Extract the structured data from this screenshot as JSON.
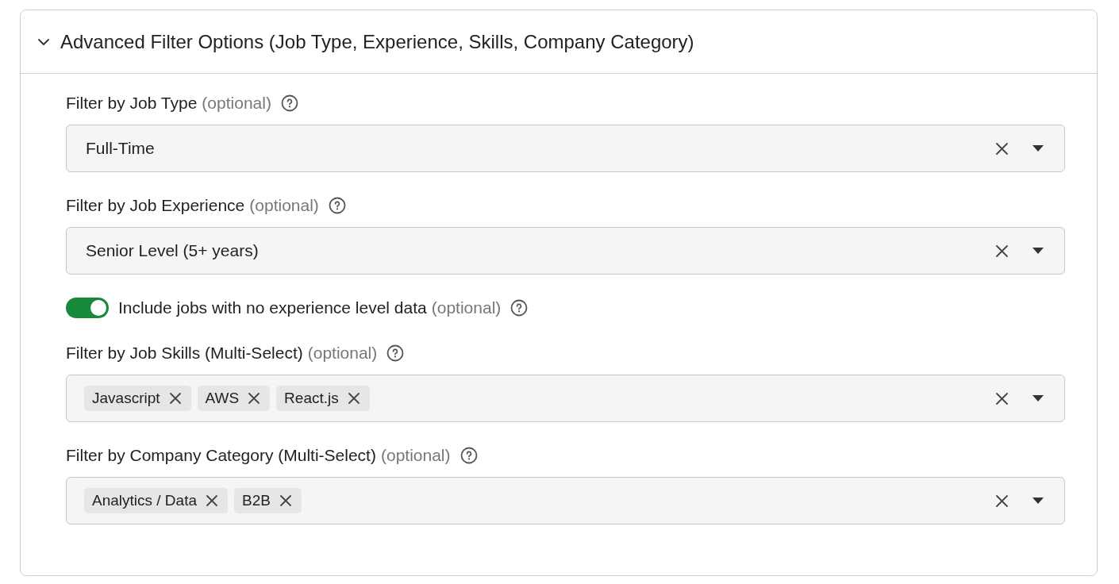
{
  "panel": {
    "title": "Advanced Filter Options (Job Type, Experience, Skills, Company Category)",
    "expanded": true
  },
  "fields": [
    {
      "kind": "select",
      "label": "Filter by Job Type",
      "hint": "(optional)",
      "value": "Full-Time"
    },
    {
      "kind": "select",
      "label": "Filter by Job Experience",
      "hint": "(optional)",
      "value": "Senior Level (5+ years)"
    },
    {
      "kind": "toggle",
      "label": "Include jobs with no experience level data",
      "hint": "(optional)",
      "on": true
    },
    {
      "kind": "multiselect",
      "label": "Filter by Job Skills (Multi-Select)",
      "hint": "(optional)",
      "tags": [
        "Javascript",
        "AWS",
        "React.js"
      ]
    },
    {
      "kind": "multiselect",
      "label": "Filter by Company Category (Multi-Select)",
      "hint": "(optional)",
      "tags": [
        "Analytics / Data",
        "B2B"
      ]
    }
  ]
}
